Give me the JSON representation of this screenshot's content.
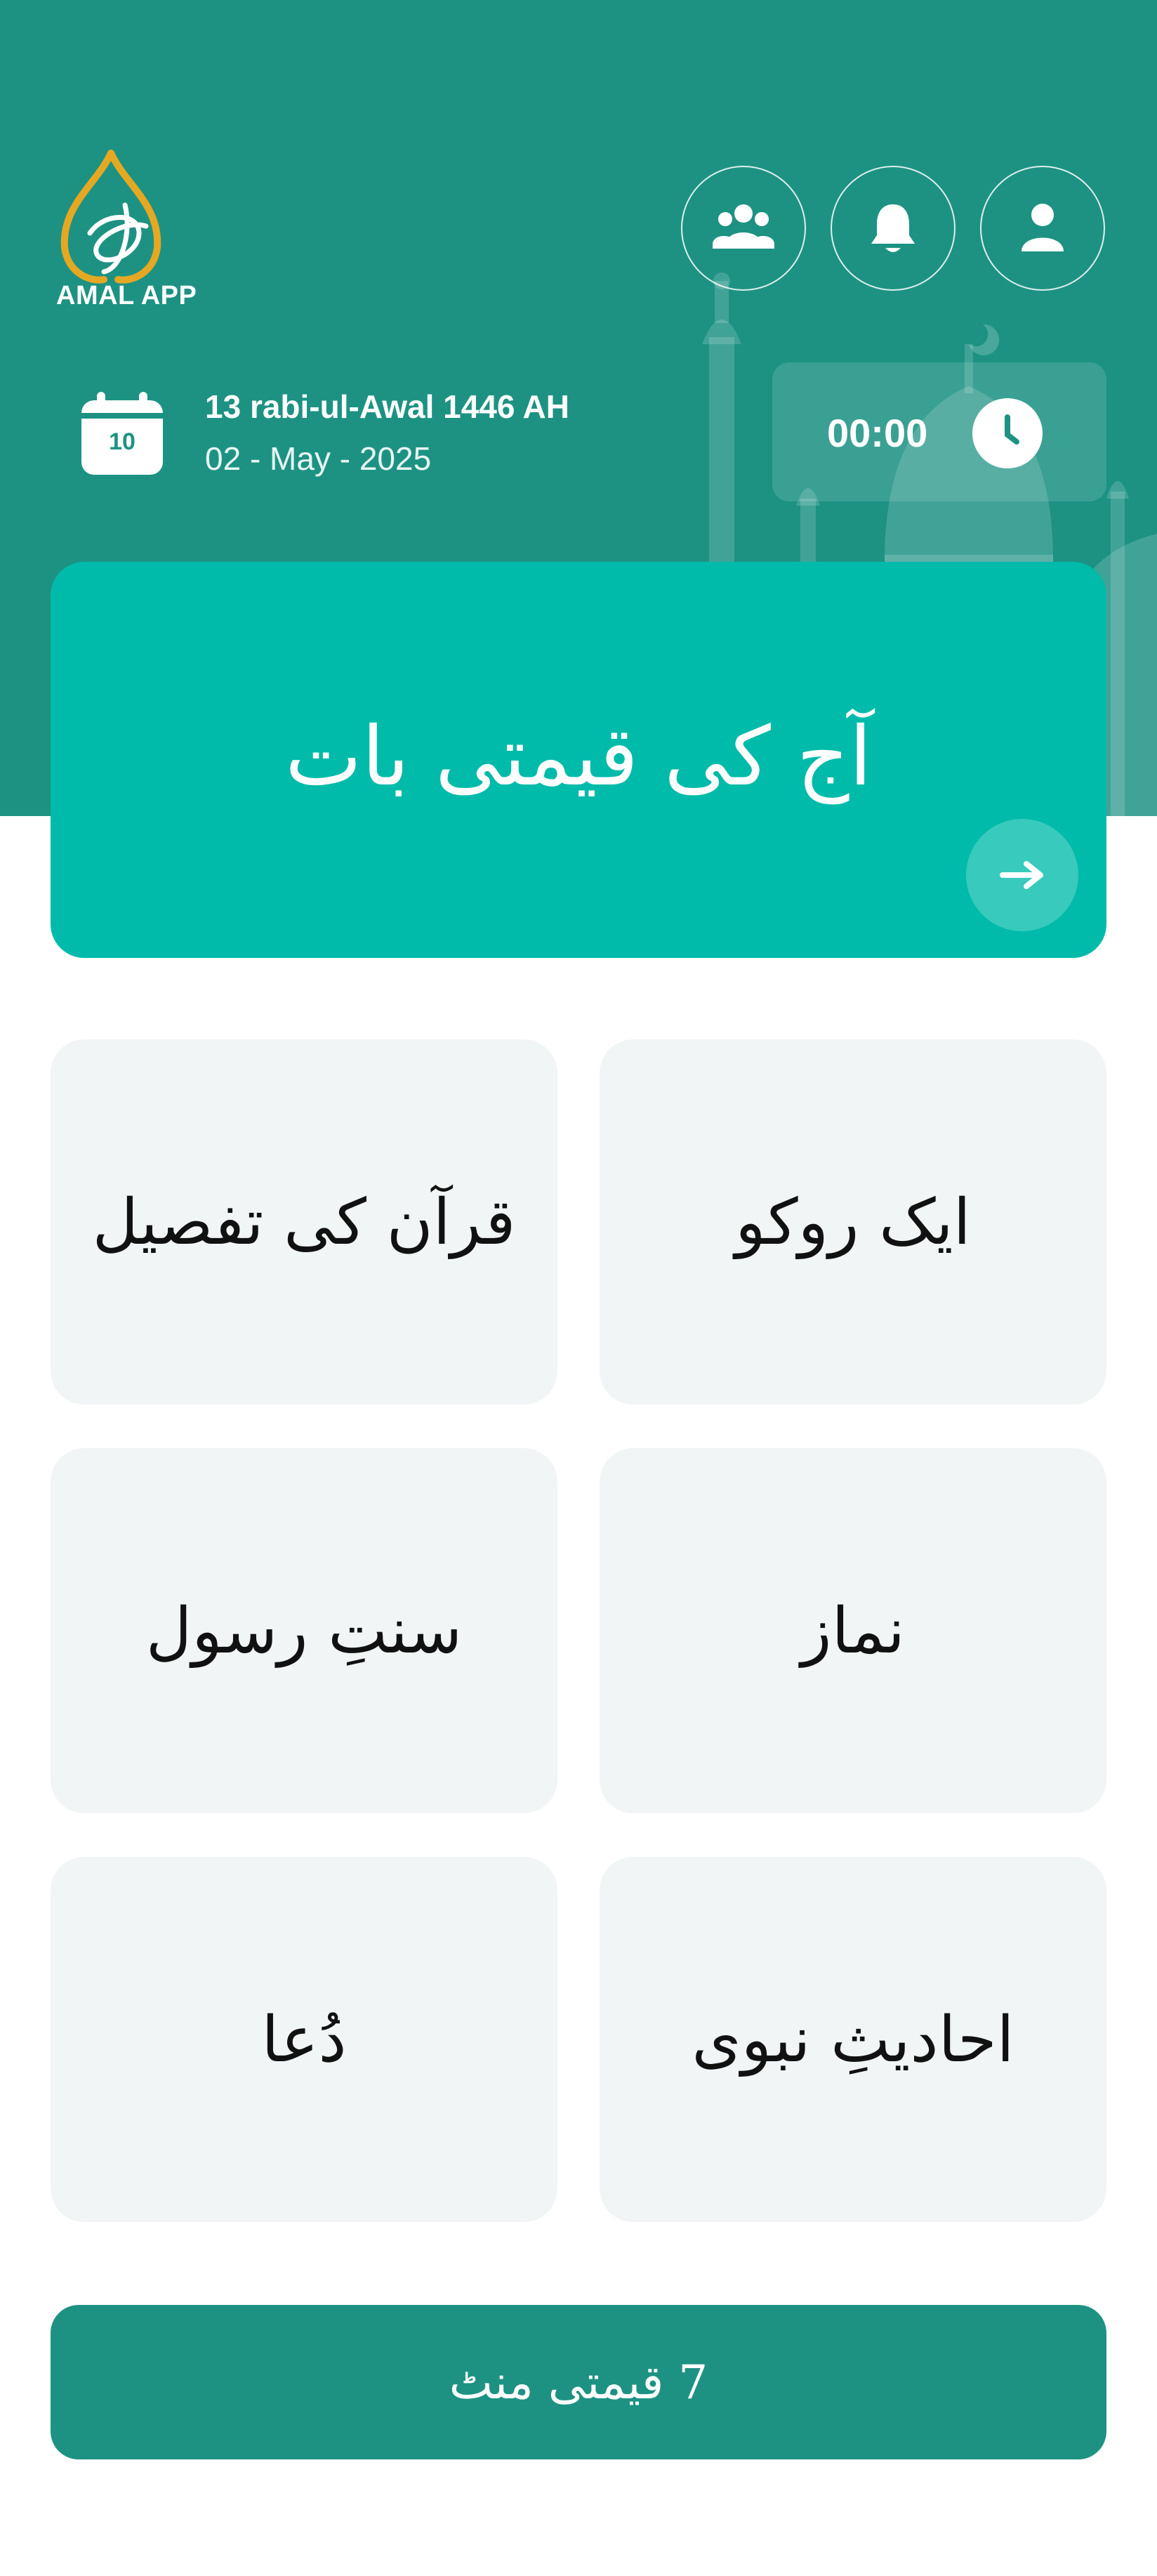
{
  "colors": {
    "primary": "#1d9283",
    "hero": "#00bba9",
    "card_bg": "#f1f5f6",
    "logo_gold": "#e5a823",
    "text_dark": "#111111"
  },
  "header": {
    "logo_text": "AMAL APP",
    "buttons": [
      {
        "icon": "community-icon"
      },
      {
        "icon": "bell-icon"
      },
      {
        "icon": "profile-icon"
      }
    ],
    "calendar_day": "10",
    "hijri_date": "13 rabi-ul-Awal 1446 AH",
    "gregorian_date": "02 - May - 2025",
    "timer": "00:00"
  },
  "hero": {
    "title": "آج کی قیمتی بات"
  },
  "grid": {
    "items": [
      {
        "label": "ایک روکو"
      },
      {
        "label": "قرآن کی تفصیل"
      },
      {
        "label": "نماز"
      },
      {
        "label": "سنتِ رسول"
      },
      {
        "label": "احادیثِ نبوی"
      },
      {
        "label": "دُعا"
      }
    ]
  },
  "footer": {
    "button_label": "7 قیمتی منٹ"
  }
}
